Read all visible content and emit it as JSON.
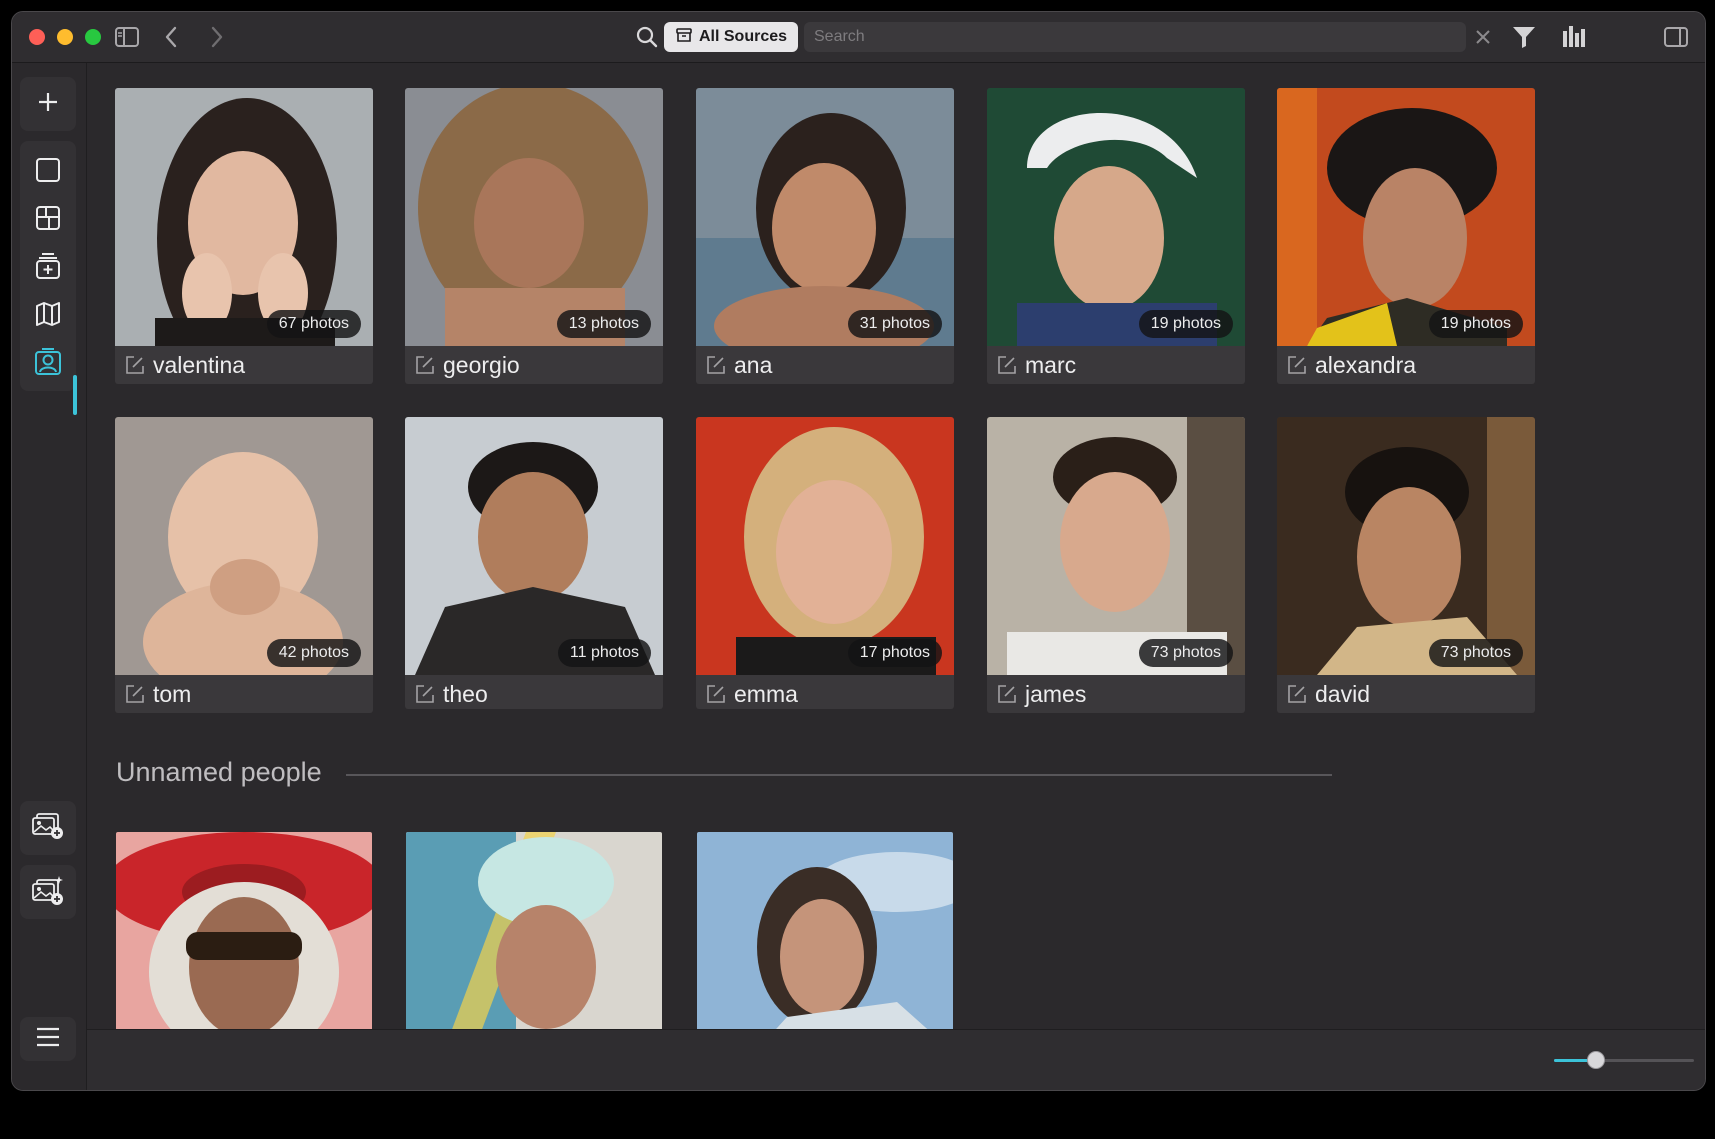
{
  "toolbar": {
    "sources_label": "All Sources",
    "search_placeholder": "Search",
    "icons": [
      "sidebar-toggle-icon",
      "back-arrow-icon",
      "forward-arrow-icon",
      "search-icon",
      "archive-box-icon",
      "clear-icon",
      "filter-icon",
      "stats-bars-icon",
      "right-panel-icon"
    ]
  },
  "sidebar": {
    "items": [
      {
        "name": "add",
        "icon": "plus-icon"
      },
      {
        "name": "single-view",
        "icon": "square-icon"
      },
      {
        "name": "grid-view",
        "icon": "grid-icon"
      },
      {
        "name": "import",
        "icon": "stack-add-icon"
      },
      {
        "name": "map",
        "icon": "map-icon"
      },
      {
        "name": "people",
        "icon": "person-portrait-icon",
        "active": true
      },
      {
        "name": "add-photos",
        "icon": "photos-add-icon"
      },
      {
        "name": "sparkle-photos",
        "icon": "photos-sparkle-icon"
      },
      {
        "name": "menu",
        "icon": "hamburger-icon"
      }
    ]
  },
  "people": [
    {
      "name": "valentina",
      "count": "67 photos"
    },
    {
      "name": "georgio",
      "count": "13 photos"
    },
    {
      "name": "ana",
      "count": "31 photos"
    },
    {
      "name": "marc",
      "count": "19 photos"
    },
    {
      "name": "alexandra",
      "count": "19 photos"
    },
    {
      "name": "tom",
      "count": "42 photos"
    },
    {
      "name": "theo",
      "count": "11 photos"
    },
    {
      "name": "emma",
      "count": "17 photos"
    },
    {
      "name": "james",
      "count": "73 photos"
    },
    {
      "name": "david",
      "count": "73 photos"
    }
  ],
  "unnamed": {
    "title": "Unnamed people",
    "count": 3
  },
  "zoom_slider": {
    "value": 0.3
  },
  "colors": {
    "accent": "#3cc3d9",
    "window_bg": "#2b292c",
    "card_bg": "#3a383b"
  }
}
